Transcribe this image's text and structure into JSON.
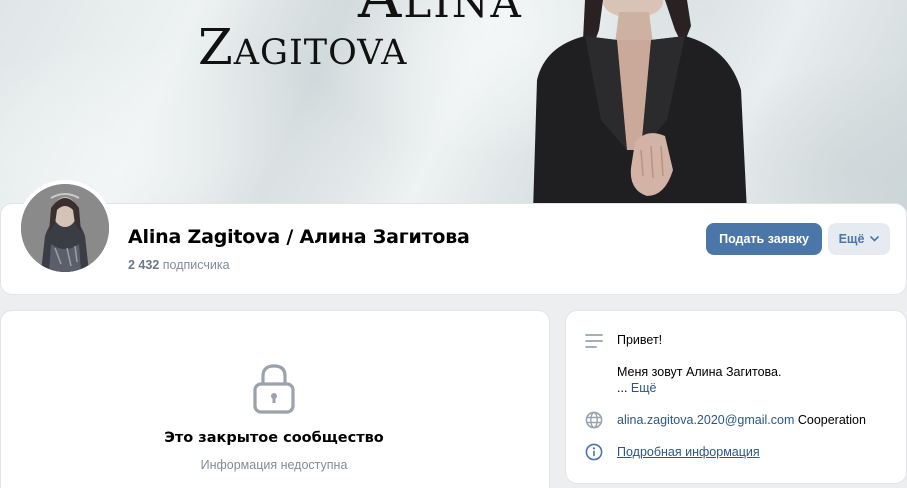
{
  "cover": {
    "title_line_1": "Alina",
    "title_line_2": "Zagitova"
  },
  "group": {
    "name": "Alina Zagitova / Алина Загитова",
    "subscribers_count": "2 432",
    "subscribers_label": "подписчика"
  },
  "actions": {
    "apply_label": "Подать заявку",
    "more_label": "Ещё"
  },
  "closed": {
    "title": "Это закрытое сообщество",
    "subtitle": "Информация недоступна"
  },
  "info": {
    "greeting": "Привет!",
    "intro": "Меня зовут Алина Загитова.",
    "ellipsis": "... ",
    "more_link": "Ещё",
    "email": "alina.zagitova.2020@gmail.com",
    "email_suffix": " Cooperation",
    "details_link": "Подробная информация"
  },
  "colors": {
    "accent": "#4a76a8",
    "link": "#2a5885",
    "secondary_text": "#818c99",
    "background": "#edeef0"
  },
  "icons": [
    "lock-icon",
    "lines-icon",
    "globe-icon",
    "info-icon",
    "chevron-down-icon"
  ]
}
